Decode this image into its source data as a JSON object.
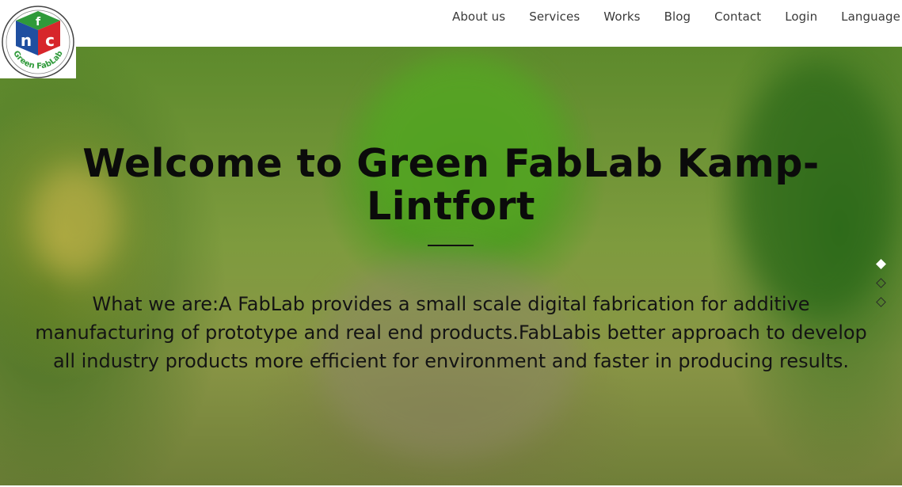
{
  "brand": {
    "logo_text": "Green FabLab",
    "logo_letters": "fnc"
  },
  "nav": {
    "items": [
      "About us",
      "Services",
      "Works",
      "Blog",
      "Contact",
      "Login",
      "Language"
    ]
  },
  "hero": {
    "title": "Welcome to Green FabLab Kamp-Lintfort",
    "description": "What we are:A FabLab provides a small scale digital fabrication for additive manufacturing of prototype and real end products.FabLabis better approach to develop all industry products more efficient for environment and faster in producing results."
  },
  "slider": {
    "slide_count": 3,
    "active_index": 0
  },
  "colors": {
    "header_bg": "#ffffff",
    "nav_text": "#3a3a3a",
    "title_text": "#0b0b0b",
    "logo_red": "#d7262b",
    "logo_blue": "#1f4fa0",
    "logo_green": "#2f9a3a"
  }
}
